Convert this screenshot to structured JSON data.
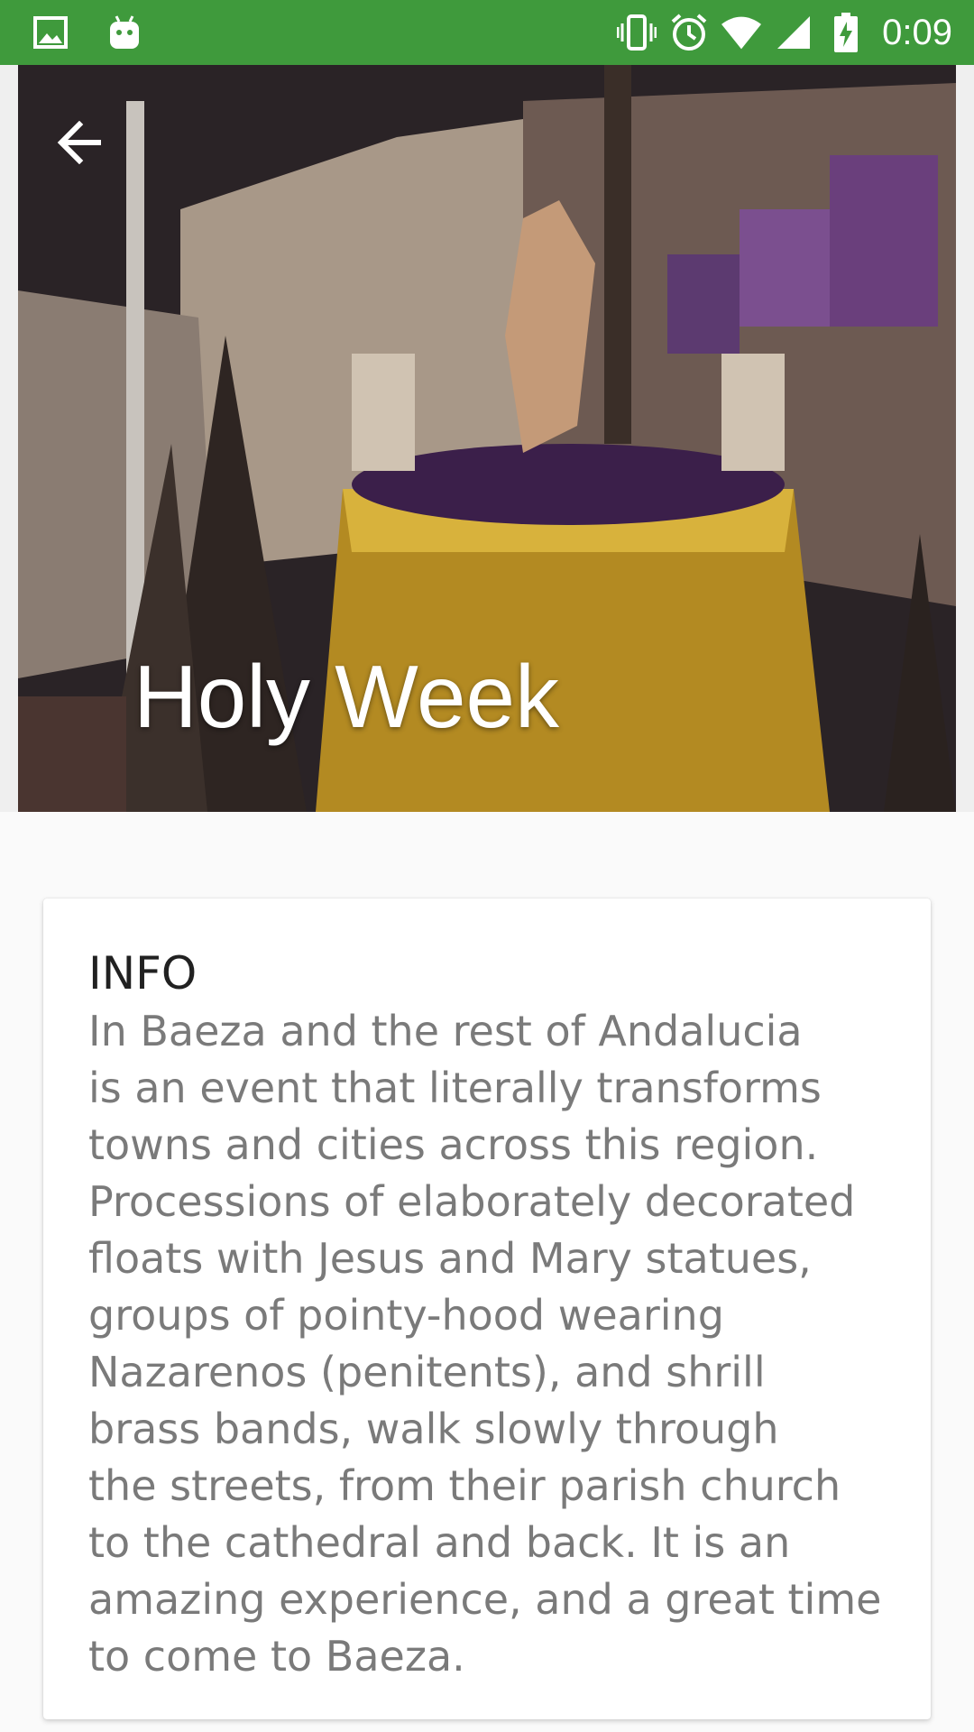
{
  "status_bar": {
    "time": "0:09",
    "left_icons": [
      "image-icon",
      "android-icon"
    ],
    "right_icons": [
      "vibrate-icon",
      "alarm-icon",
      "wifi-icon",
      "signal-icon",
      "battery-charging-icon"
    ],
    "background": "#3f9a3c"
  },
  "hero": {
    "title": "Holy Week",
    "back_icon": "arrow-left-icon"
  },
  "info_card": {
    "heading": "INFO",
    "body": "In Baeza and the rest of Andalucia\nis an event that literally transforms\ntowns and cities across this region.\nProcessions of elaborately decorated\nfloats with Jesus and Mary statues,\ngroups of pointy-hood wearing\nNazarenos (penitents), and shrill\nbrass bands, walk slowly through\nthe streets, from their parish church\nto the cathedral and back. It is an\namazing experience, and a great time\nto come to Baeza."
  }
}
